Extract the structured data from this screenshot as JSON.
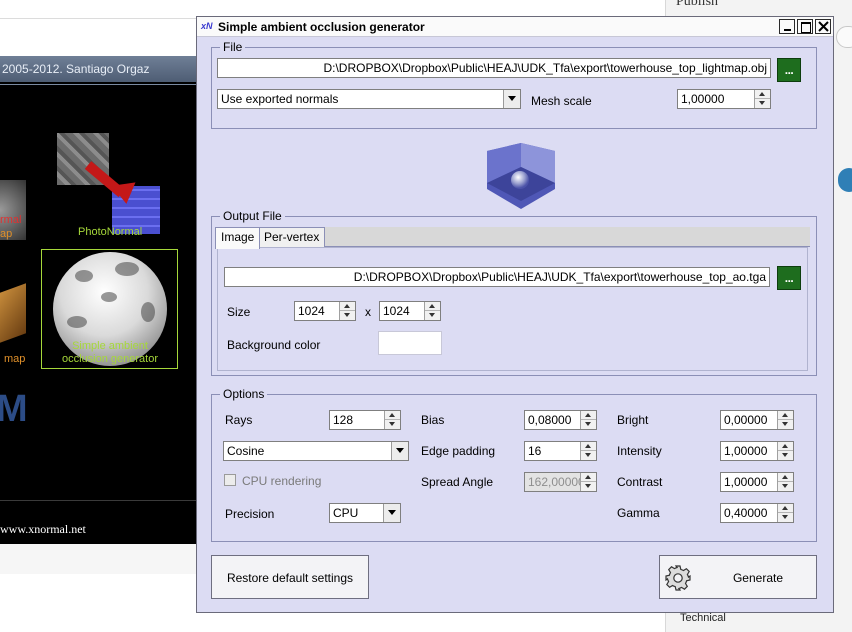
{
  "background": {
    "right_panel_title": "Publish",
    "right_panel_bottom": "Technical",
    "launcher_copyright": "2005-2012. Santiago Orgaz",
    "launcher_labels": {
      "normal_map_partial": "rmal",
      "map_partial_left": "ap",
      "photonormal": "PhotoNormal",
      "map_label": "map",
      "sao": "Simple ambient occlusion generator"
    },
    "launcher_url": "www.xnormal.net"
  },
  "dialog": {
    "logo": "xN",
    "title": "Simple ambient occlusion generator",
    "file_group": {
      "legend": "File",
      "path": "D:\\DROPBOX\\Dropbox\\Public\\HEAJ\\UDK_Tfa\\export\\towerhouse_top_lightmap.obj",
      "browse_label": "...",
      "normals_selected": "Use exported normals",
      "mesh_scale_label": "Mesh scale",
      "mesh_scale_value": "1,00000"
    },
    "output_group": {
      "legend": "Output File",
      "tabs": [
        "Image",
        "Per-vertex"
      ],
      "path": "D:\\DROPBOX\\Dropbox\\Public\\HEAJ\\UDK_Tfa\\export\\towerhouse_top_ao.tga",
      "browse_label": "...",
      "size_label": "Size",
      "size_width": "1024",
      "size_x": "x",
      "size_height": "1024",
      "background_color_label": "Background color",
      "background_color": "#ffffff"
    },
    "options_group": {
      "legend": "Options",
      "rays_label": "Rays",
      "rays_value": "128",
      "distribution_selected": "Cosine",
      "cpu_rendering_label": "CPU rendering",
      "precision_label": "Precision",
      "precision_selected": "CPU",
      "bias_label": "Bias",
      "bias_value": "0,08000",
      "edge_padding_label": "Edge padding",
      "edge_padding_value": "16",
      "spread_angle_label": "Spread Angle",
      "spread_angle_value": "162,00000",
      "bright_label": "Bright",
      "bright_value": "0,00000",
      "intensity_label": "Intensity",
      "intensity_value": "1,00000",
      "contrast_label": "Contrast",
      "contrast_value": "1,00000",
      "gamma_label": "Gamma",
      "gamma_value": "0,40000"
    },
    "buttons": {
      "restore": "Restore default settings",
      "generate": "Generate"
    }
  },
  "colors": {
    "dialog_bg": "#dcdcf3",
    "browse_green": "#1e6d1e",
    "launcher_label_green": "#a6d83a",
    "arrow_red": "#c41818"
  },
  "icons": [
    "minimize-icon",
    "maximize-icon",
    "close-icon",
    "gear-icon",
    "dropdown-arrow-icon",
    "spin-up-icon",
    "spin-down-icon",
    "ao-preview-cube-icon"
  ]
}
